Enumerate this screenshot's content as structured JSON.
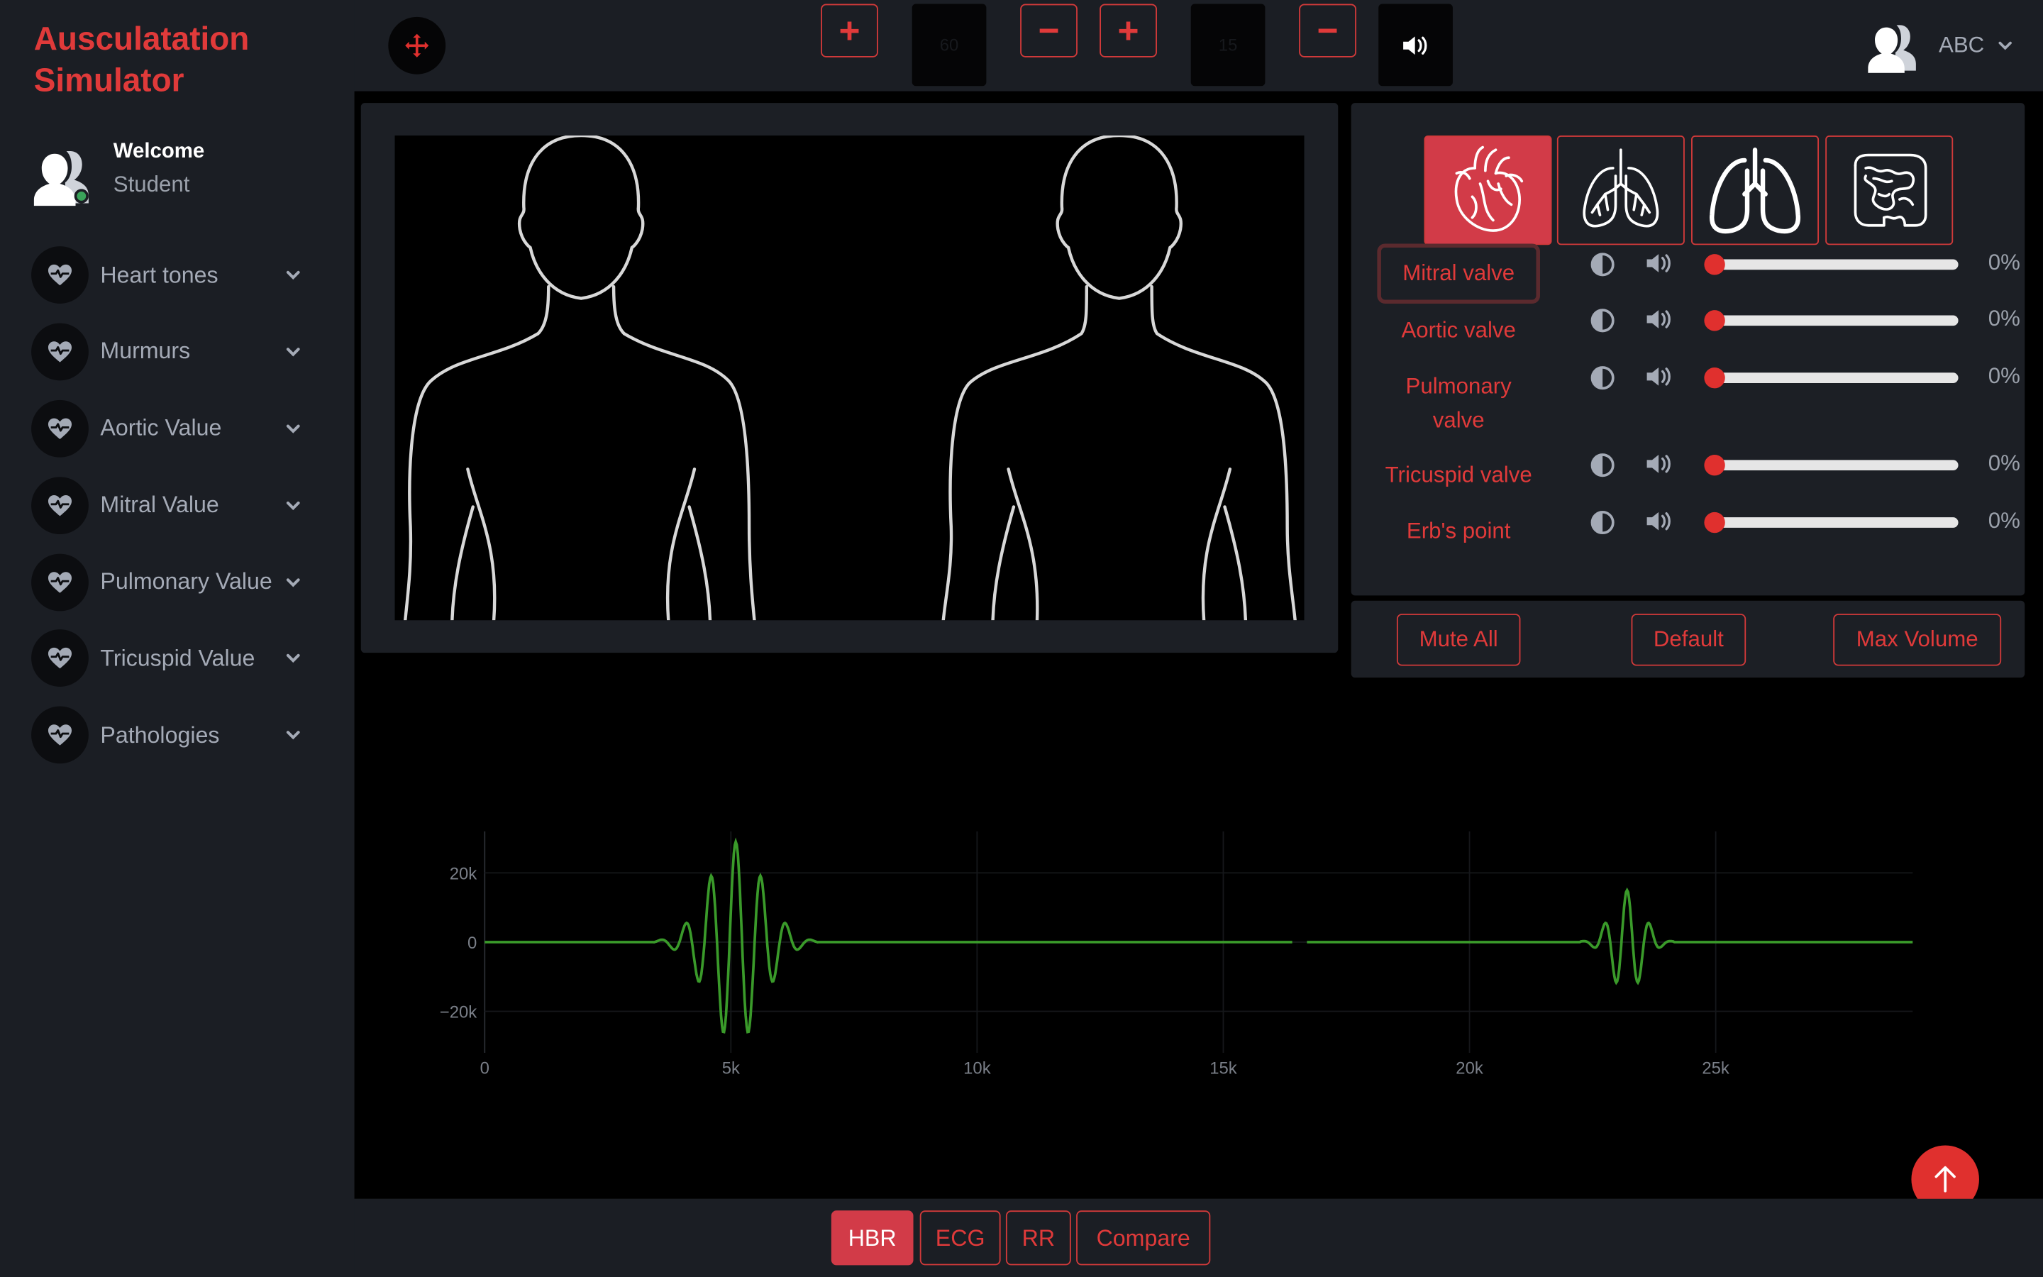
{
  "app": {
    "title": "Ausculatation Simulator"
  },
  "user": {
    "welcome": "Welcome",
    "role": "Student",
    "profile_name": "ABC"
  },
  "sidebar": {
    "items": [
      {
        "label": "Heart tones"
      },
      {
        "label": "Murmurs"
      },
      {
        "label": "Aortic Value"
      },
      {
        "label": "Mitral Value"
      },
      {
        "label": "Pulmonary Value"
      },
      {
        "label": "Tricuspid Value"
      },
      {
        "label": "Pathologies"
      }
    ]
  },
  "topbar": {
    "plus": "+",
    "minus": "−",
    "bpm_value": "60",
    "rr_value": "15"
  },
  "organs": [
    {
      "icon": "heart-icon",
      "active": true
    },
    {
      "icon": "lungs-bronchi-icon",
      "active": false
    },
    {
      "icon": "lungs-icon",
      "active": false
    },
    {
      "icon": "intestines-icon",
      "active": false
    }
  ],
  "valves": [
    {
      "label": "Mitral valve",
      "volume": "0%",
      "selected": true
    },
    {
      "label": "Aortic valve",
      "volume": "0%"
    },
    {
      "label": "Pulmonary valve",
      "volume": "0%"
    },
    {
      "label": "Tricuspid valve",
      "volume": "0%"
    },
    {
      "label": "Erb's point",
      "volume": "0%"
    }
  ],
  "actions": {
    "mute_all": "Mute All",
    "default": "Default",
    "max_volume": "Max Volume"
  },
  "tabs": [
    {
      "label": "HBR",
      "active": true
    },
    {
      "label": "ECG"
    },
    {
      "label": "RR"
    },
    {
      "label": "Compare"
    }
  ],
  "colors": {
    "accent": "#e03a3a",
    "active_fill": "#d23b48",
    "signal": "#3a9a2a"
  },
  "chart_data": {
    "type": "line",
    "x_ticks": [
      "0",
      "5k",
      "10k",
      "15k",
      "20k",
      "25k"
    ],
    "y_ticks": [
      "20k",
      "0",
      "−20k"
    ],
    "xlim": [
      0,
      29000
    ],
    "ylim": [
      -32000,
      32000
    ],
    "grid": true,
    "bursts": [
      {
        "center": 5100,
        "amplitude": 29000,
        "cycles": 5.5,
        "halfwidth": 1400
      },
      {
        "center": 23200,
        "amplitude": 15000,
        "cycles": 3.5,
        "halfwidth": 800
      }
    ],
    "gap": [
      16400,
      16700
    ]
  }
}
